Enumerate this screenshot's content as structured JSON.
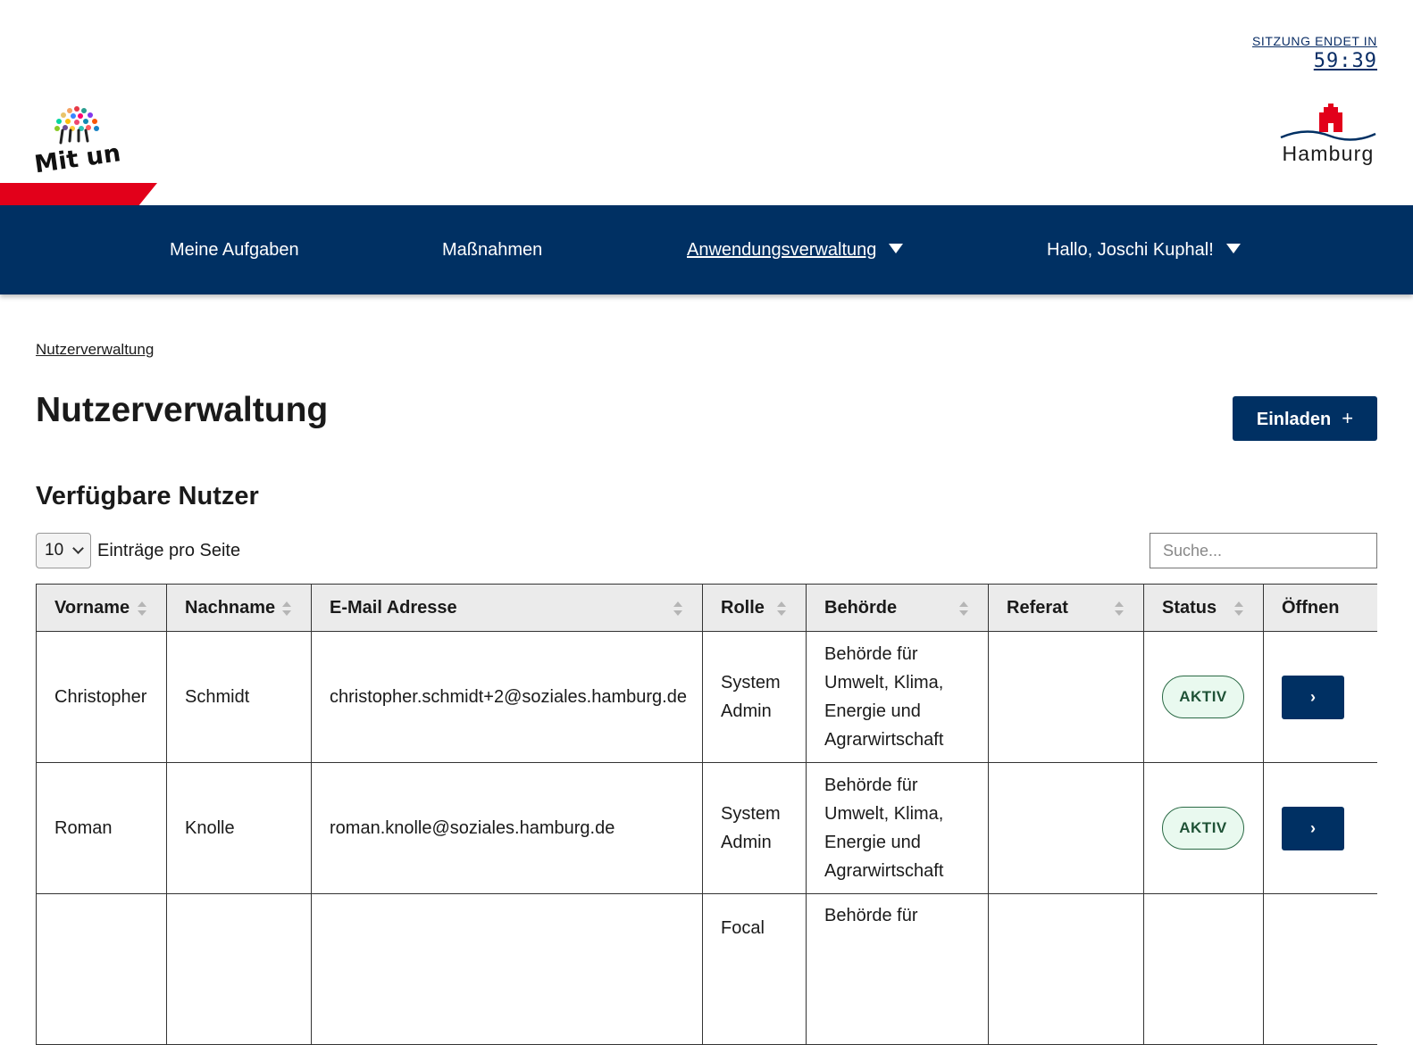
{
  "session": {
    "label": "SITZUNG ENDET IN",
    "time": "59:39"
  },
  "logos": {
    "left_text": "Mit uns!",
    "right_text": "Hamburg",
    "right_icon": "hamburg-castle-icon"
  },
  "colors": {
    "navy": "#003063",
    "red": "#e2001a",
    "badge_bg": "#e9f9ef"
  },
  "nav": {
    "items": [
      {
        "label": "Meine Aufgaben"
      },
      {
        "label": "Maßnahmen"
      },
      {
        "label": "Anwendungsverwaltung"
      },
      {
        "label": "Hallo, Joschi Kuphal!"
      }
    ]
  },
  "breadcrumb": "Nutzerverwaltung",
  "page": {
    "title": "Nutzerverwaltung",
    "invite_label": "Einladen",
    "invite_icon": "+",
    "section_title": "Verfügbare Nutzer"
  },
  "controls": {
    "page_size": "10",
    "page_size_label": "Einträge pro Seite",
    "search_placeholder": "Suche..."
  },
  "table": {
    "columns": [
      "Vorname",
      "Nachname",
      "E-Mail Adresse",
      "Rolle",
      "Behörde",
      "Referat",
      "Status",
      "Öffnen"
    ],
    "rows": [
      {
        "vorname": "Christopher",
        "nachname": "Schmidt",
        "email": "christopher.schmidt+2@soziales.hamburg.de",
        "rolle": "System Admin",
        "behoerde": "Behörde für Umwelt, Klima, Energie und Agrarwirtschaft",
        "referat": "",
        "status": "AKTIV",
        "open": "›"
      },
      {
        "vorname": "Roman",
        "nachname": "Knolle",
        "email": "roman.knolle@soziales.hamburg.de",
        "rolle": "System Admin",
        "behoerde": "Behörde für Umwelt, Klima, Energie und Agrarwirtschaft",
        "referat": "",
        "status": "AKTIV",
        "open": "›"
      },
      {
        "vorname": "",
        "nachname": "",
        "email": "",
        "rolle": "Focal",
        "behoerde": "Behörde für",
        "referat": "",
        "status": "",
        "open": ""
      }
    ]
  }
}
